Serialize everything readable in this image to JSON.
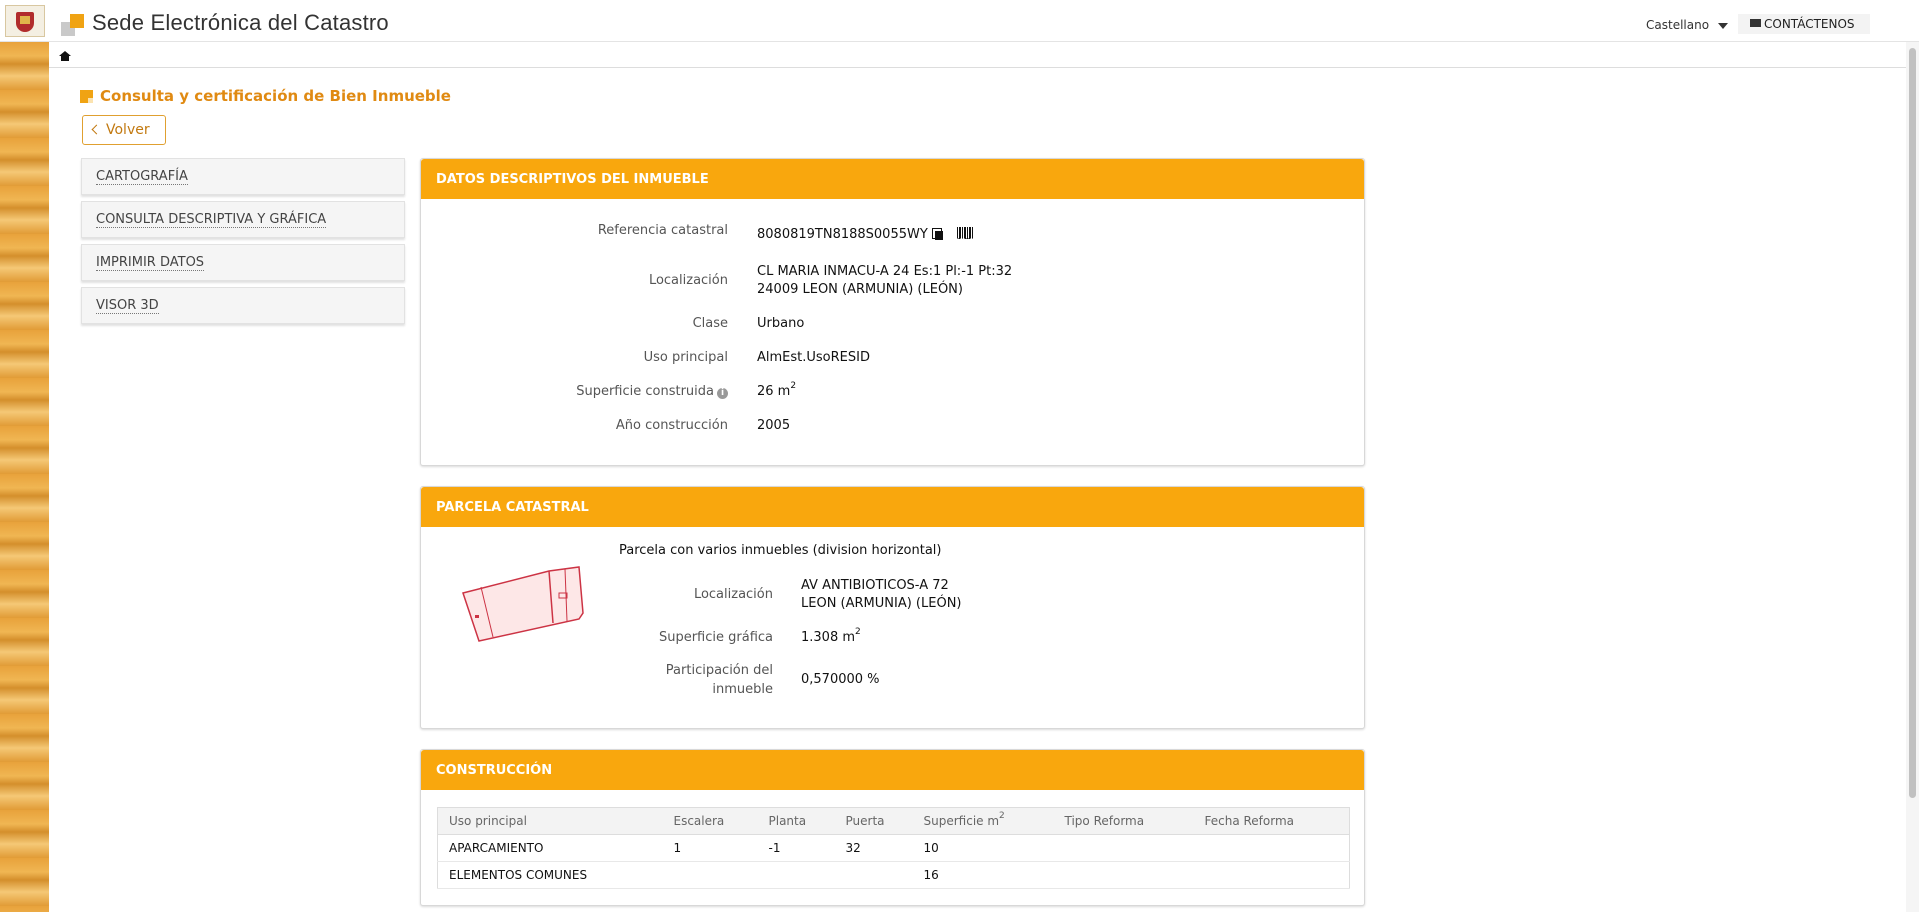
{
  "header": {
    "site_title": "Sede Electrónica del Catastro",
    "language": "Castellano",
    "contact_label": "CONTÁCTENOS"
  },
  "page": {
    "title": "Consulta y certificación de Bien Inmueble",
    "back_label": "Volver"
  },
  "menu": {
    "items": [
      {
        "label": "CARTOGRAFÍA"
      },
      {
        "label": "CONSULTA DESCRIPTIVA Y GRÁFICA"
      },
      {
        "label": "IMPRIMIR DATOS"
      },
      {
        "label": "VISOR 3D"
      }
    ]
  },
  "descriptivos": {
    "title": "DATOS DESCRIPTIVOS DEL INMUEBLE",
    "ref_label": "Referencia catastral",
    "ref_value": "8080819TN8188S0055WY",
    "loc_label": "Localización",
    "loc_line1": "CL MARIA INMACU-A 24 Es:1 Pl:-1 Pt:32",
    "loc_line2": "24009 LEON (ARMUNIA) (LEÓN)",
    "clase_label": "Clase",
    "clase_value": "Urbano",
    "uso_label": "Uso principal",
    "uso_value": "AlmEst.UsoRESID",
    "sup_label": "Superficie construida",
    "sup_value": "26 m",
    "sup_unit_exp": "2",
    "anio_label": "Año construcción",
    "anio_value": "2005"
  },
  "parcela": {
    "title": "PARCELA CATASTRAL",
    "descripcion": "Parcela con varios inmuebles (division horizontal)",
    "loc_label": "Localización",
    "loc_line1": "AV ANTIBIOTICOS-A 72",
    "loc_line2": "LEON (ARMUNIA) (LEÓN)",
    "sup_label": "Superficie gráfica",
    "sup_value": "1.308 m",
    "sup_unit_exp": "2",
    "part_label_1": "Participación del",
    "part_label_2": "inmueble",
    "part_value": "0,570000 %"
  },
  "construccion": {
    "title": "CONSTRUCCIÓN",
    "columns": [
      "Uso principal",
      "Escalera",
      "Planta",
      "Puerta",
      "Superficie m",
      "Tipo Reforma",
      "Fecha Reforma"
    ],
    "col_exp": "2",
    "rows": [
      [
        "APARCAMIENTO",
        "1",
        "-1",
        "32",
        "10",
        "",
        ""
      ],
      [
        "ELEMENTOS COMUNES",
        "",
        "",
        "",
        "16",
        "",
        ""
      ]
    ]
  }
}
